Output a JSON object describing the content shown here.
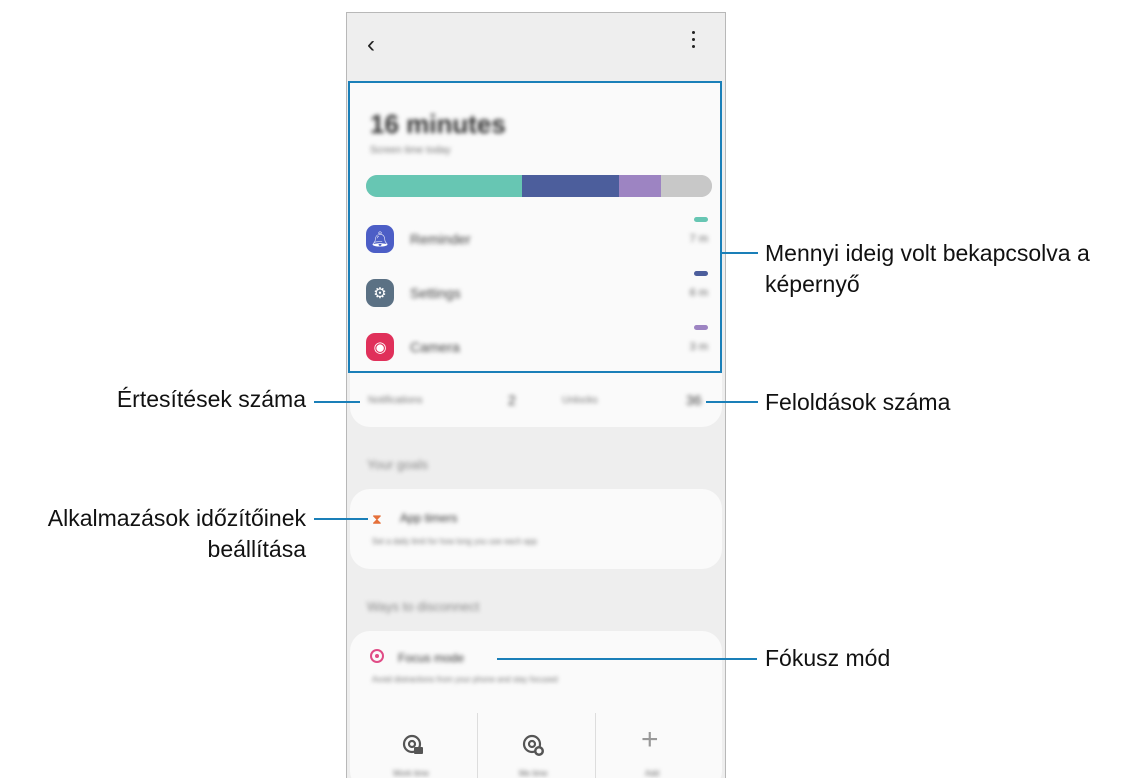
{
  "header": {
    "back_icon": "chevron-left-icon",
    "menu_icon": "more-vertical-icon"
  },
  "summary": {
    "total_time": "16 minutes",
    "subtitle": "Screen time today",
    "segments": [
      {
        "color": "#67c6b3",
        "fraction": 0.45
      },
      {
        "color": "#4c5e9c",
        "fraction": 0.28
      },
      {
        "color": "#9d84c2",
        "fraction": 0.12
      },
      {
        "color": "#c8c8c8",
        "fraction": 0.15
      }
    ]
  },
  "apps": [
    {
      "name": "Reminder",
      "time": "7 m",
      "icon": "bell-icon",
      "icon_bg": "#4c5ec6",
      "dash": "#67c6b3"
    },
    {
      "name": "Settings",
      "time": "6 m",
      "icon": "gear-icon",
      "icon_bg": "#5b7184",
      "dash": "#4c5e9c"
    },
    {
      "name": "Camera",
      "time": "3 m",
      "icon": "camera-icon",
      "icon_bg": "#e0305a",
      "dash": "#9d84c2"
    }
  ],
  "stats": {
    "notifications_label": "Notifications",
    "notifications_value": "2",
    "unlocks_label": "Unlocks",
    "unlocks_value": "36"
  },
  "goals": {
    "heading": "Your goals",
    "timer_title": "App timers",
    "timer_desc": "Set a daily limit for how long you use each app"
  },
  "disconnect": {
    "heading": "Ways to disconnect",
    "focus_title": "Focus mode",
    "focus_desc": "Avoid distractions from your phone and stay focused",
    "tiles": [
      "Work time",
      "Me time",
      "Add"
    ]
  },
  "callouts": {
    "screen_on": [
      "Mennyi ideig volt bekapcsolva a",
      "képernyő"
    ],
    "unlocks": "Feloldások száma",
    "notifications": "Értesítések száma",
    "timers": [
      "Alkalmazások időzítőinek",
      "beállítása"
    ],
    "focus": "Fókusz mód"
  },
  "accent": "#1a7fb8"
}
